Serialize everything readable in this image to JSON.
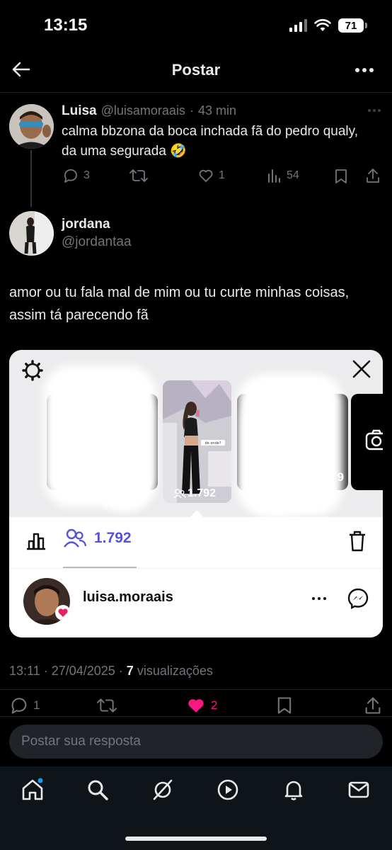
{
  "status_bar": {
    "time": "13:15",
    "battery": "71"
  },
  "topbar": {
    "title": "Postar"
  },
  "parent_tweet": {
    "name": "Luisa",
    "handle": "@luisamoraais",
    "separator": "·",
    "time": "43 min",
    "text": "calma bbzona da boca inchada fã do pedro qualy, da uma segurada 🤣",
    "replies": "3",
    "likes": "1",
    "views": "54"
  },
  "main_tweet": {
    "name": "jordana",
    "handle": "@jordantaa",
    "text": "amor ou tu fala mal de mim ou tu curte minhas coisas, assim tá parecendo fã",
    "timestamp": "13:11 · 27/04/2025 · ",
    "views_count": "7",
    "views_label": " visualizações",
    "replies": "1",
    "likes": "2"
  },
  "story_card": {
    "story_viewers_overlay": "1.792",
    "side_story_count": "9",
    "sticker_text": "de onde?",
    "viewers_count": "1.792",
    "viewer_username": "luisa.moraais"
  },
  "reply": {
    "placeholder": "Postar sua resposta"
  },
  "colors": {
    "like": "#f91880",
    "accent": "#5851db",
    "background": "#000000"
  }
}
